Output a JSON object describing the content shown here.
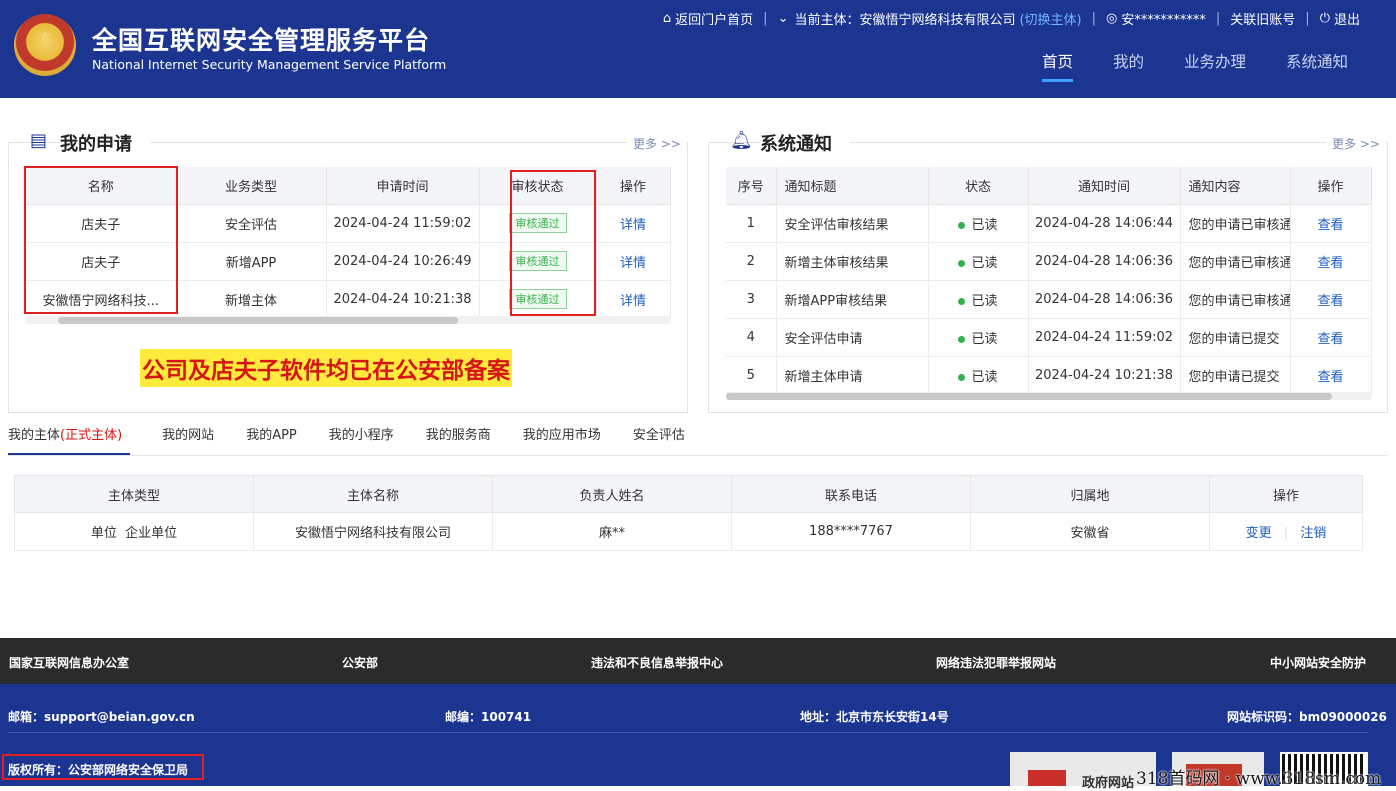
{
  "header": {
    "title_cn": "全国互联网安全管理服务平台",
    "title_en": "National Internet Security Management Service Platform",
    "back_portal": "返回门户首页",
    "current_entity_label": "当前主体：安徽悟宁网络科技有限公司",
    "switch_entity": "(切换主体)",
    "user": "安***********",
    "link_old": "关联旧账号",
    "logout": "退出",
    "nav": [
      "首页",
      "我的",
      "业务办理",
      "系统通知"
    ]
  },
  "applications": {
    "title": "我的申请",
    "more": "更多 >>",
    "columns": [
      "名称",
      "业务类型",
      "申请时间",
      "审核状态",
      "操作"
    ],
    "rows": [
      {
        "name": "店夫子",
        "type": "安全评估",
        "time": "2024-04-24 11:59:02",
        "status": "审核通过",
        "action": "详情"
      },
      {
        "name": "店夫子",
        "type": "新增APP",
        "time": "2024-04-24 10:26:49",
        "status": "审核通过",
        "action": "详情"
      },
      {
        "name": "安徽悟宁网络科技...",
        "type": "新增主体",
        "time": "2024-04-24 10:21:38",
        "status": "审核通过",
        "action": "详情"
      }
    ],
    "annotation": "公司及店夫子软件均已在公安部备案"
  },
  "notices": {
    "title": "系统通知",
    "more": "更多 >>",
    "columns": [
      "序号",
      "通知标题",
      "状态",
      "通知时间",
      "通知内容",
      "操作"
    ],
    "rows": [
      {
        "no": "1",
        "title": "安全评估审核结果",
        "status": "已读",
        "time": "2024-04-28 14:06:44",
        "content": "您的申请已审核通",
        "action": "查看"
      },
      {
        "no": "2",
        "title": "新增主体审核结果",
        "status": "已读",
        "time": "2024-04-28 14:06:36",
        "content": "您的申请已审核通",
        "action": "查看"
      },
      {
        "no": "3",
        "title": "新增APP审核结果",
        "status": "已读",
        "time": "2024-04-28 14:06:36",
        "content": "您的申请已审核通",
        "action": "查看"
      },
      {
        "no": "4",
        "title": "安全评估申请",
        "status": "已读",
        "time": "2024-04-24 11:59:02",
        "content": "您的申请已提交",
        "action": "查看"
      },
      {
        "no": "5",
        "title": "新增主体申请",
        "status": "已读",
        "time": "2024-04-24 10:21:38",
        "content": "您的申请已提交",
        "action": "查看"
      }
    ]
  },
  "tabs": {
    "first": "我的主体",
    "first_badge": "(正式主体)",
    "others": [
      "我的网站",
      "我的APP",
      "我的小程序",
      "我的服务商",
      "我的应用市场",
      "安全评估"
    ]
  },
  "entity_table": {
    "columns": [
      "主体类型",
      "主体名称",
      "负责人姓名",
      "联系电话",
      "归属地",
      "操作"
    ],
    "row": {
      "type": "单位  企业单位",
      "name": "安徽悟宁网络科技有限公司",
      "person": "麻**",
      "phone": "188****7767",
      "region": "安徽省",
      "change": "变更",
      "cancel": "注销"
    }
  },
  "footer": {
    "links": [
      "国家互联网信息办公室",
      "公安部",
      "违法和不良信息举报中心",
      "网络违法犯罪举报网站",
      "中小网站安全防护"
    ],
    "email": "邮箱：support@beian.gov.cn",
    "postcode": "邮编：100741",
    "address": "地址：北京市东长安街14号",
    "site_id": "网站标识码：bm09000026",
    "copyright": "版权所有：公安部网络安全保卫局",
    "badge_text": "政府网站",
    "watermark": "318首码网 · www.318sm.com"
  },
  "colors": {
    "primary": "#1b3591",
    "accent_red": "#e02020",
    "highlight_bg": "#ffeb3b",
    "ok_green": "#39b54a"
  }
}
